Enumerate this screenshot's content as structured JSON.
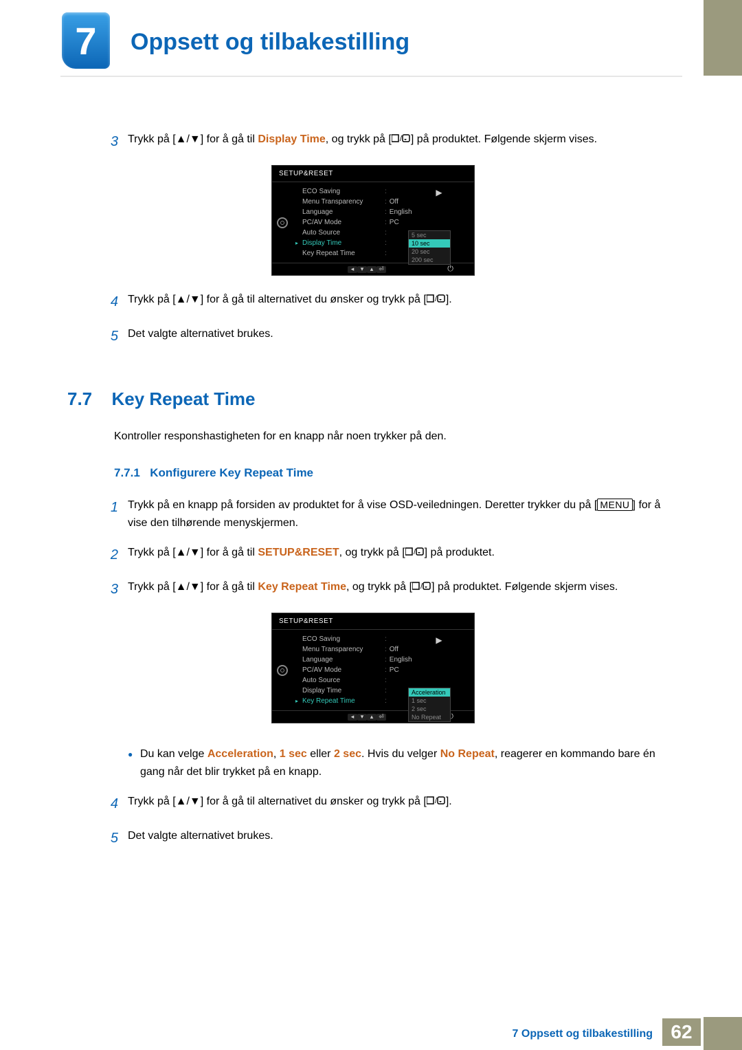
{
  "chapter": {
    "number": "7",
    "title": "Oppsett og tilbakestilling"
  },
  "footer": {
    "text": "7 Oppsett og tilbakestilling",
    "page": "62"
  },
  "steps_a": {
    "s3_pre": "Trykk på [",
    "s3_mid1": "] for å gå til ",
    "s3_accent": "Display Time",
    "s3_mid2": ", og trykk på [",
    "s3_post": "] på produktet. Følgende skjerm vises.",
    "s4_pre": "Trykk på [",
    "s4_mid": "] for å gå til alternativet du ønsker og trykk på [",
    "s4_post": "].",
    "s5": "Det valgte alternativet brukes."
  },
  "section77": {
    "num": "7.7",
    "title": "Key Repeat Time",
    "desc": "Kontroller responshastigheten for en knapp når noen trykker på den."
  },
  "sub771": {
    "num": "7.7.1",
    "title": "Konfigurere Key Repeat Time"
  },
  "steps_b": {
    "s1a": "Trykk på en knapp på forsiden av produktet for å vise OSD-veiledningen. Deretter trykker du på [",
    "s1b": "] for å vise den tilhørende menyskjermen.",
    "menu_key": "MENU",
    "s2_pre": "Trykk på [",
    "s2_mid1": "] for å gå til ",
    "s2_accent": "SETUP&RESET",
    "s2_mid2": ", og trykk på [",
    "s2_post": "] på produktet.",
    "s3_pre": "Trykk på [",
    "s3_mid1": "] for å gå til ",
    "s3_accent": "Key Repeat Time",
    "s3_mid2": ", og trykk på [",
    "s3_post": "] på produktet. Følgende skjerm vises.",
    "bul_pre": "Du kan velge ",
    "bul_a": "Acceleration",
    "bul_sep1": ", ",
    "bul_b": "1 sec",
    "bul_sep2": " eller ",
    "bul_c": "2 sec",
    "bul_mid": ". Hvis du velger ",
    "bul_d": "No Repeat",
    "bul_post": ", reagerer en kommando bare én gang når det blir trykket på en knapp.",
    "s4_pre": "Trykk på [",
    "s4_mid": "] for å gå til alternativet du ønsker og trykk på [",
    "s4_post": "].",
    "s5": "Det valgte alternativet brukes."
  },
  "osd_common": {
    "title": "SETUP&RESET",
    "items": [
      "ECO Saving",
      "Menu Transparency",
      "Language",
      "PC/AV Mode",
      "Auto Source",
      "Display Time",
      "Key Repeat Time"
    ],
    "vals": [
      "",
      "Off",
      "English",
      "PC",
      "",
      "",
      ""
    ]
  },
  "osd1": {
    "active_index": 5,
    "popup": [
      "5 sec",
      "10 sec",
      "20 sec",
      "200 sec"
    ],
    "popup_sel": 1
  },
  "osd2": {
    "active_index": 6,
    "popup": [
      "Acceleration",
      "1 sec",
      "2 sec",
      "No Repeat"
    ],
    "popup_sel": 0
  },
  "nums": {
    "n1": "1",
    "n2": "2",
    "n3": "3",
    "n4": "4",
    "n5": "5"
  }
}
